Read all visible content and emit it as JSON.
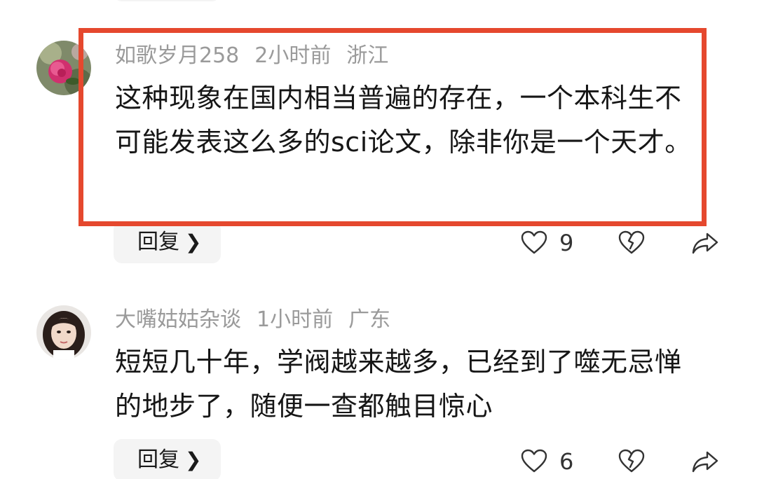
{
  "comments": [
    {
      "username": "如歌岁月258",
      "time": "2小时前",
      "location": "浙江",
      "text": "这种现象在国内相当普遍的存在，一个本科生不可能发表这么多的sci论文，除非你是一个天才。",
      "reply_label": "回复",
      "like_count": "9",
      "avatar": "rose-photo"
    },
    {
      "username": "大嘴姑姑杂谈",
      "time": "1小时前",
      "location": "广东",
      "text": "短短几十年，学阀越来越多，已经到了噬无忌惮的地步了，随便一查都触目惊心",
      "reply_label": "回复",
      "like_count": "6",
      "avatar": "woman-portrait"
    }
  ],
  "icons": {
    "like": "heart-outline-icon",
    "dislike": "broken-heart-icon",
    "share": "share-arrow-icon",
    "reply_chevron": "chevron-right-icon"
  },
  "colors": {
    "highlight_border": "#e5482e",
    "meta_text": "#9a9a9a",
    "button_bg": "#f4f4f4"
  }
}
